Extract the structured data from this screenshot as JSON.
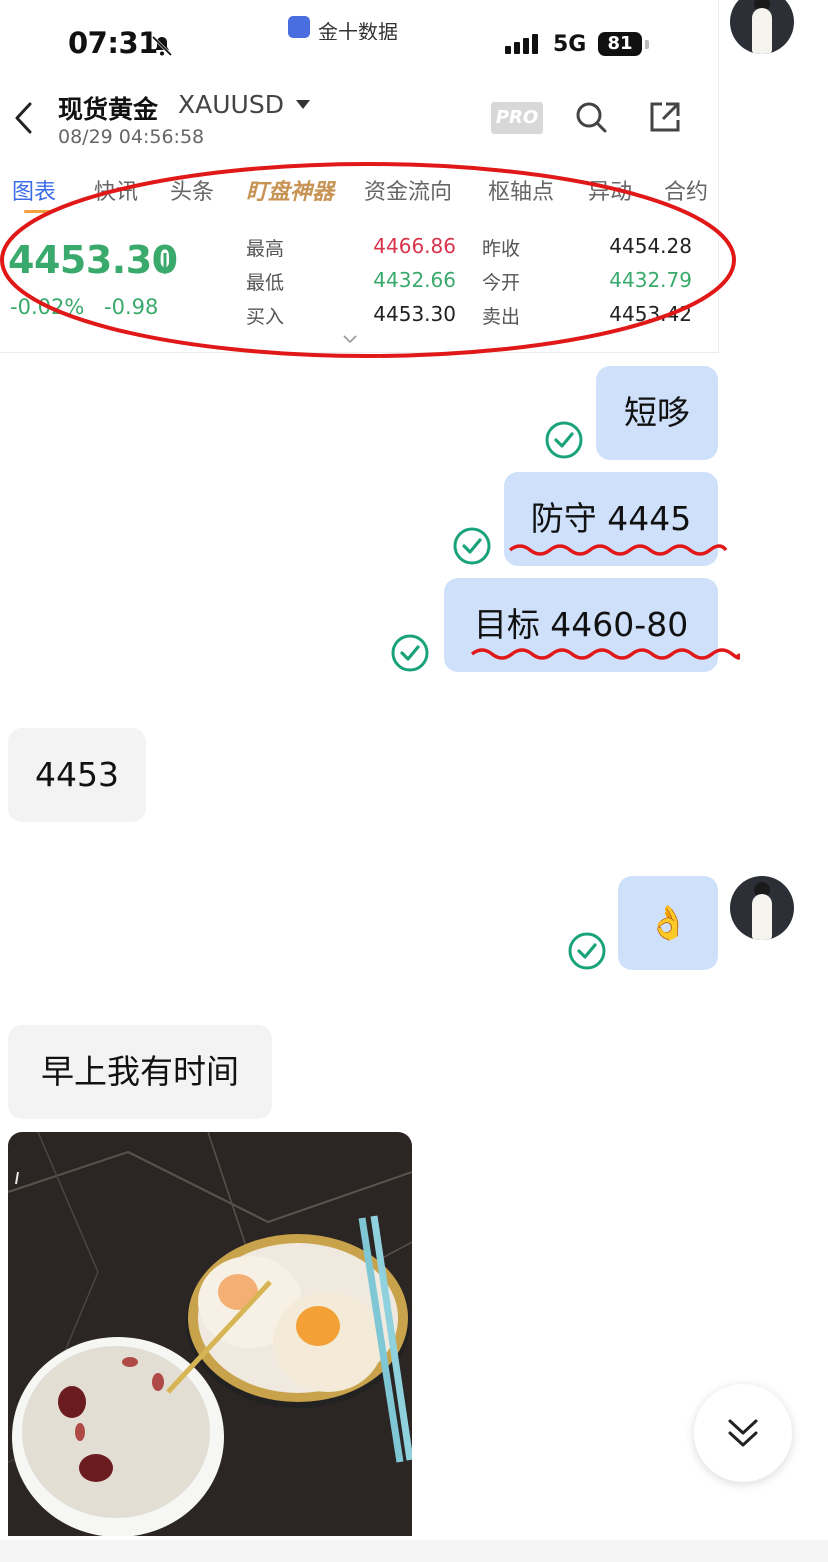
{
  "status_bar": {
    "time": "07:31",
    "app_badge": "金十数据",
    "network": "5G",
    "battery": "81"
  },
  "quote_header": {
    "title": "现货黄金",
    "symbol": "XAUUSD",
    "datetime": "08/29 04:56:58",
    "pro_label": "PRO"
  },
  "tabs": [
    {
      "label": "图表"
    },
    {
      "label": "快讯"
    },
    {
      "label": "头条"
    },
    {
      "label": "盯盘神器"
    },
    {
      "label": "资金流向"
    },
    {
      "label": "枢轴点"
    },
    {
      "label": "异动"
    },
    {
      "label": "合约"
    }
  ],
  "quote": {
    "price": "4453.30",
    "change_pct": "-0.02%",
    "change_abs": "-0.98",
    "high_label": "最高",
    "high": "4466.86",
    "low_label": "最低",
    "low": "4432.66",
    "bid_label": "买入",
    "bid": "4453.30",
    "prev_close_label": "昨收",
    "prev_close": "4454.28",
    "open_label": "今开",
    "open": "4432.79",
    "ask_label": "卖出",
    "ask": "4453.42"
  },
  "messages": [
    {
      "side": "mine",
      "text": "短哆"
    },
    {
      "side": "mine",
      "text": "防守 4445"
    },
    {
      "side": "mine",
      "text": "目标 4460-80"
    },
    {
      "side": "theirs",
      "text": "4453"
    },
    {
      "side": "mine",
      "text": "👌"
    },
    {
      "side": "theirs",
      "text": "早上我有时间"
    }
  ],
  "colors": {
    "up": "#d8344b",
    "down": "#3aaa6c",
    "accent": "#3b6ce8",
    "mine_bubble": "#cfe0fb",
    "theirs_bubble": "#f3f3f3",
    "check": "#1aa37a",
    "annotation": "#e01818"
  },
  "icons": [
    "bell-off-icon",
    "signal-icon",
    "back-icon",
    "search-icon",
    "share-icon",
    "check-icon",
    "scroll-down-icon"
  ]
}
